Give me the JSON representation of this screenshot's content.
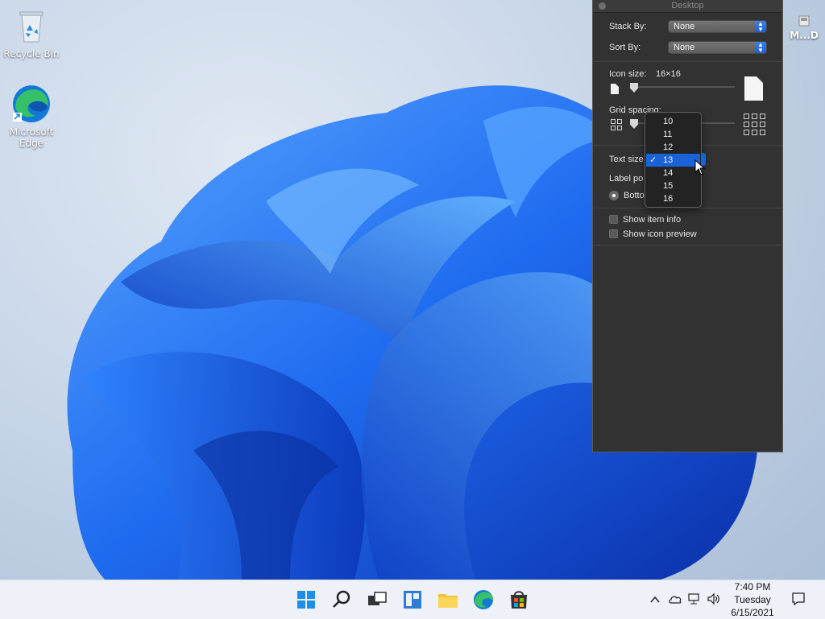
{
  "desktop": {
    "recycle_bin": "Recycle Bin",
    "edge_line1": "Microsoft",
    "edge_line2": "Edge",
    "drive_label": "M...D"
  },
  "panel": {
    "title": "Desktop",
    "stack_by_label": "Stack By:",
    "stack_by_value": "None",
    "sort_by_label": "Sort By:",
    "sort_by_value": "None",
    "icon_size_label": "Icon size:",
    "icon_size_value": "16×16",
    "grid_spacing_label": "Grid spacing:",
    "text_size_label": "Text size",
    "label_position_label": "Label po",
    "label_position_value": "Botto",
    "show_item_info": "Show item info",
    "show_icon_preview": "Show icon preview"
  },
  "text_size_dropdown": {
    "options": [
      "10",
      "11",
      "12",
      "13",
      "14",
      "15",
      "16"
    ],
    "selected": "13"
  },
  "taskbar": {
    "time": "7:40 PM",
    "day": "Tuesday",
    "date": "6/15/2021"
  },
  "colors": {
    "accent": "#1a63d6",
    "panel_bg": "#323232",
    "taskbar_bg": "#eef2f8"
  }
}
